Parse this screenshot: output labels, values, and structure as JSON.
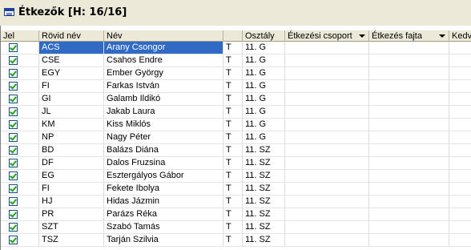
{
  "window": {
    "title": "Étkezők [H: 16/16]",
    "icon": "window-icon"
  },
  "grid": {
    "columns": {
      "jel": "Jel",
      "rovid_nev": "Rövid név",
      "nev": "Név",
      "t": "",
      "osztaly": "Osztály",
      "etkezesi_csoport": "Étkezési csoport",
      "etkezes_fajta": "Étkezés fajta",
      "kedvezmeny": "Kedve"
    },
    "selected_index": 0,
    "rows": [
      {
        "checked": true,
        "rovid": "ACS",
        "nev": "Arany Csongor",
        "t": "T",
        "osztaly": "11. G"
      },
      {
        "checked": true,
        "rovid": "CSE",
        "nev": "Csahos Endre",
        "t": "T",
        "osztaly": "11. G"
      },
      {
        "checked": true,
        "rovid": "EGY",
        "nev": "Ember György",
        "t": "T",
        "osztaly": "11. G"
      },
      {
        "checked": true,
        "rovid": "FI",
        "nev": "Farkas István",
        "t": "T",
        "osztaly": "11. G"
      },
      {
        "checked": true,
        "rovid": "GI",
        "nev": "Galamb Ildikó",
        "t": "T",
        "osztaly": "11. G"
      },
      {
        "checked": true,
        "rovid": "JL",
        "nev": "Jakab Laura",
        "t": "T",
        "osztaly": "11. G"
      },
      {
        "checked": true,
        "rovid": "KM",
        "nev": "Kiss Miklós",
        "t": "T",
        "osztaly": "11. G"
      },
      {
        "checked": true,
        "rovid": "NP",
        "nev": "Nagy Péter",
        "t": "T",
        "osztaly": "11. G"
      },
      {
        "checked": true,
        "rovid": "BD",
        "nev": "Balázs Diána",
        "t": "T",
        "osztaly": "11. SZ"
      },
      {
        "checked": true,
        "rovid": "DF",
        "nev": "Dalos Fruzsina",
        "t": "T",
        "osztaly": "11. SZ"
      },
      {
        "checked": true,
        "rovid": "EG",
        "nev": "Esztergályos Gábor",
        "t": "T",
        "osztaly": "11. SZ"
      },
      {
        "checked": true,
        "rovid": "FI",
        "nev": "Fekete Ibolya",
        "t": "T",
        "osztaly": "11. SZ"
      },
      {
        "checked": true,
        "rovid": "HJ",
        "nev": "Hidas Jázmin",
        "t": "T",
        "osztaly": "11. SZ"
      },
      {
        "checked": true,
        "rovid": "PR",
        "nev": "Parázs Réka",
        "t": "T",
        "osztaly": "11. SZ"
      },
      {
        "checked": true,
        "rovid": "SZT",
        "nev": "Szabó Tamás",
        "t": "T",
        "osztaly": "11. SZ"
      },
      {
        "checked": true,
        "rovid": "TSZ",
        "nev": "Tarján Szilvia",
        "t": "T",
        "osztaly": "11. SZ"
      }
    ]
  },
  "colors": {
    "selection": "#316ac5",
    "header_bg": "#ece9d8",
    "check": "#21a121"
  }
}
